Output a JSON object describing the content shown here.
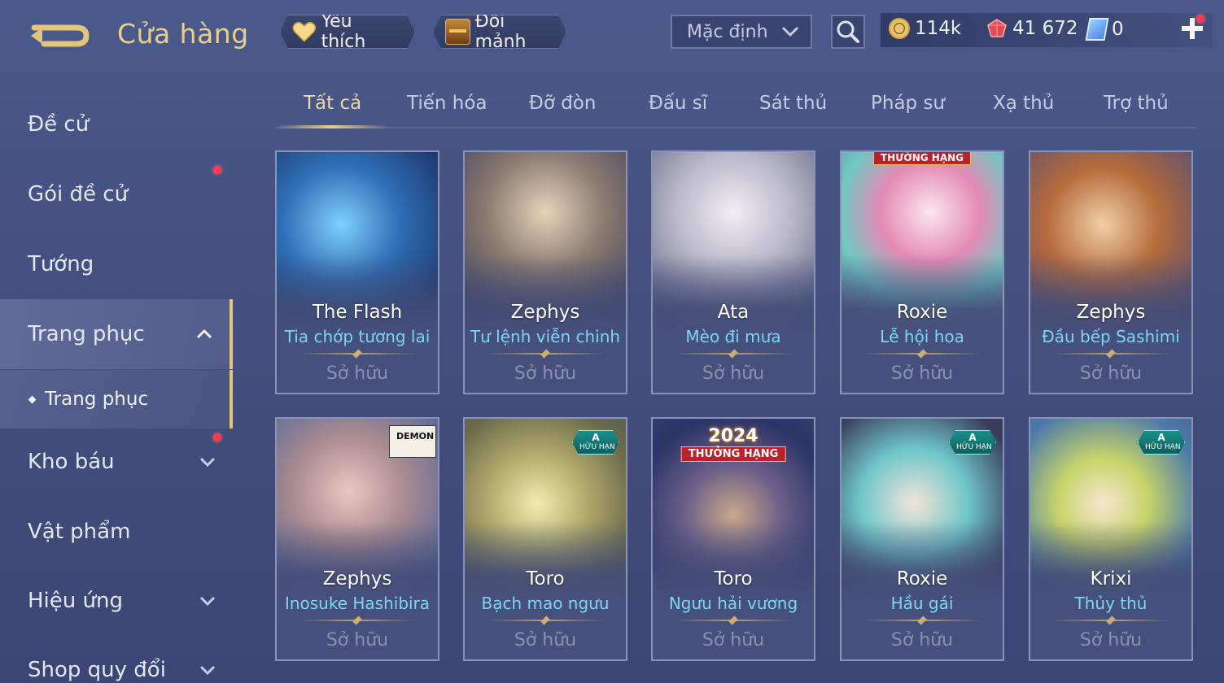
{
  "header": {
    "title": "Cửa hàng",
    "favorites_label": "Yêu thích",
    "trade_label": "Đổi mảnh",
    "sort_value": "Mặc định",
    "currencies": {
      "gold": "114k",
      "gems": "41 672",
      "vouchers": "0"
    }
  },
  "sidebar": {
    "items": [
      {
        "label": "Đề cử"
      },
      {
        "label": "Gói đề cử"
      },
      {
        "label": "Tướng"
      },
      {
        "label": "Trang phục"
      },
      {
        "label": "Kho báu"
      },
      {
        "label": "Vật phẩm"
      },
      {
        "label": "Hiệu ứng"
      },
      {
        "label": "Shop quy đổi"
      }
    ],
    "sub_item": "Trang phục"
  },
  "tabs": [
    "Tất cả",
    "Tiến hóa",
    "Đỡ đòn",
    "Đấu sĩ",
    "Sát thủ",
    "Pháp sư",
    "Xạ thủ",
    "Trợ thủ"
  ],
  "cards": [
    {
      "hero": "The Flash",
      "skin": "Tia chớp tương lai",
      "status": "Sở hữu"
    },
    {
      "hero": "Zephys",
      "skin": "Tư lệnh viễn chinh",
      "status": "Sở hữu"
    },
    {
      "hero": "Ata",
      "skin": "Mèo đi mưa",
      "status": "Sở hữu"
    },
    {
      "hero": "Roxie",
      "skin": "Lễ hội hoa",
      "status": "Sở hữu",
      "badge": "THƯỜNG HẠNG"
    },
    {
      "hero": "Zephys",
      "skin": "Đầu bếp Sashimi",
      "status": "Sở hữu"
    },
    {
      "hero": "Zephys",
      "skin": "Inosuke Hashibira",
      "status": "Sở hữu",
      "badge": "DEMON SLAYER"
    },
    {
      "hero": "Toro",
      "skin": "Bạch mao ngưu",
      "status": "Sở hữu",
      "badge": "A",
      "badge_sub": "HỮU HẠN"
    },
    {
      "hero": "Toro",
      "skin": "Ngưu hải vương",
      "status": "Sở hữu",
      "badge": "2024",
      "badge_sub": "THƯỞNG HẠNG"
    },
    {
      "hero": "Roxie",
      "skin": "Hầu gái",
      "status": "Sở hữu",
      "badge": "A",
      "badge_sub": "HỮU HẠN"
    },
    {
      "hero": "Krixi",
      "skin": "Thủy thủ",
      "status": "Sở hữu",
      "badge": "A",
      "badge_sub": "HỮU HẠN"
    }
  ],
  "colors": {
    "accent_gold": "#e8cf8c",
    "skin_name": "#7fd4f4",
    "notification": "#ff3b4a"
  }
}
